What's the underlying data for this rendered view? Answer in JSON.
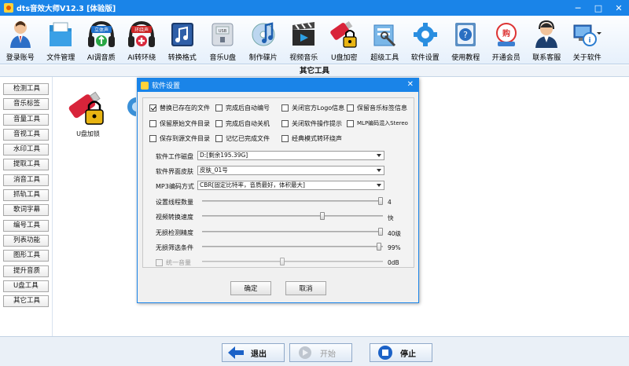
{
  "window": {
    "title": "dts音效大师V12.3 [体验版]",
    "minimize": "─",
    "maximize": "□",
    "close": "✕"
  },
  "toolbar": [
    {
      "label": "登录账号",
      "icon": "user-login-icon"
    },
    {
      "label": "文件管理",
      "icon": "file-folder-icon"
    },
    {
      "label": "AI调音质",
      "icon": "stereo-headphones-icon",
      "badge": "立体声"
    },
    {
      "label": "AI转环绕",
      "icon": "surround-headphones-icon",
      "badge": "环绕声"
    },
    {
      "label": "转换格式",
      "icon": "music-note-convert-icon"
    },
    {
      "label": "音乐U盘",
      "icon": "usb-drive-icon"
    },
    {
      "label": "制作碟片",
      "icon": "cd-music-icon"
    },
    {
      "label": "视频音乐",
      "icon": "video-clapper-icon"
    },
    {
      "label": "U盘加密",
      "icon": "usb-lock-icon"
    },
    {
      "label": "超级工具",
      "icon": "toolbox-icon"
    },
    {
      "label": "软件设置",
      "icon": "gear-settings-icon"
    },
    {
      "label": "使用教程",
      "icon": "help-book-icon"
    },
    {
      "label": "开通会员",
      "icon": "shopping-vip-icon"
    },
    {
      "label": "联系客服",
      "icon": "customer-service-icon"
    },
    {
      "label": "关于软件",
      "icon": "about-computer-icon"
    }
  ],
  "section_title": "其它工具",
  "sidebar": [
    "检测工具",
    "音乐标签",
    "音量工具",
    "音视工具",
    "水印工具",
    "提取工具",
    "消音工具",
    "抓轨工具",
    "歌词字幕",
    "编号工具",
    "列表功能",
    "图形工具",
    "提升音质",
    "U盘工具",
    "其它工具"
  ],
  "content": {
    "usb_item_label": "U盘加锁"
  },
  "dialog": {
    "title": "软件设置",
    "close": "✕",
    "checkboxes": [
      {
        "label": "替换已存在的文件",
        "checked": true
      },
      {
        "label": "完成后自动编号",
        "checked": false
      },
      {
        "label": "关闭官方Logo信息",
        "checked": false
      },
      {
        "label": "保留音乐标签信息",
        "checked": false
      },
      {
        "label": "保留原始文件目录",
        "checked": false
      },
      {
        "label": "完成后自动关机",
        "checked": false
      },
      {
        "label": "关闭软件操作提示",
        "checked": false
      },
      {
        "label": "MLP编码混入Stereo",
        "checked": false
      },
      {
        "label": "保存到源文件目录",
        "checked": false
      },
      {
        "label": "记忆已完成文件",
        "checked": false
      },
      {
        "label": "经典模式转环绕声",
        "checked": false
      }
    ],
    "disk_label": "软件工作磁盘",
    "disk_value": "D:[剩余195.39G]",
    "skin_label": "软件界面皮肤",
    "skin_value": "皮肤_01号",
    "mp3_label": "MP3编码方式",
    "mp3_value": "CBR[固定比特率，音质最好，体积最大]",
    "sliders": [
      {
        "label": "设置线程数量",
        "value": "4",
        "level": 1.0,
        "disabled": false
      },
      {
        "label": "视频转换速度",
        "value": "快",
        "level": 0.67,
        "disabled": false
      },
      {
        "label": "无损检测精度",
        "value": "40级",
        "level": 1.0,
        "disabled": false
      },
      {
        "label": "无损筛选条件",
        "value": "99%",
        "level": 0.99,
        "disabled": false
      },
      {
        "label": "统一音量",
        "value": "0dB",
        "level": 0.44,
        "disabled": true
      }
    ],
    "ok": "确定",
    "cancel": "取消"
  },
  "bottom": {
    "exit": "退出",
    "start": "开始",
    "stop": "停止"
  },
  "colors": {
    "titlebar": "#1a84e8",
    "usb_red": "#d8243a",
    "lock_gold": "#e8b412"
  }
}
